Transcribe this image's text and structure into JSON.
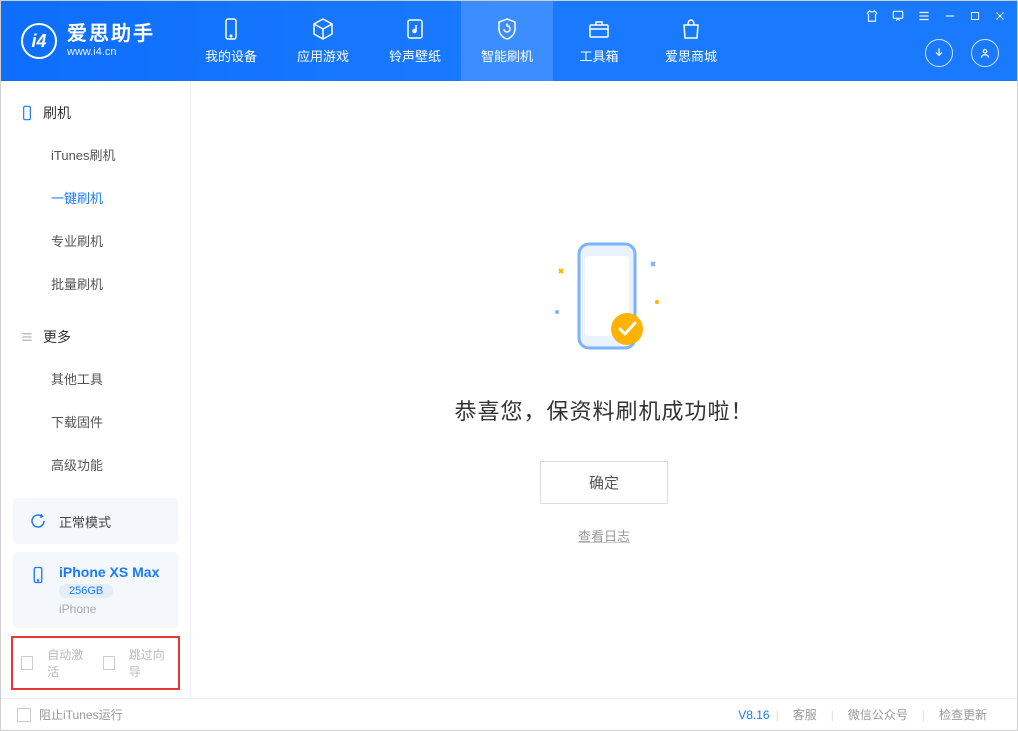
{
  "app": {
    "title": "爱思助手",
    "subtitle": "www.i4.cn"
  },
  "nav": {
    "my_device": "我的设备",
    "apps_games": "应用游戏",
    "ring_wall": "铃声壁纸",
    "smart_flash": "智能刷机",
    "toolbox": "工具箱",
    "store": "爱思商城"
  },
  "sidebar": {
    "section_flash": "刷机",
    "items_flash": {
      "itunes": "iTunes刷机",
      "oneclick": "一键刷机",
      "pro": "专业刷机",
      "batch": "批量刷机"
    },
    "section_more": "更多",
    "items_more": {
      "other_tools": "其他工具",
      "download_fw": "下载固件",
      "advanced": "高级功能"
    }
  },
  "device": {
    "mode": "正常模式",
    "name": "iPhone XS Max",
    "storage": "256GB",
    "type": "iPhone"
  },
  "options": {
    "auto_activate": "自动激活",
    "skip_guide": "跳过向导"
  },
  "main": {
    "success": "恭喜您，保资料刷机成功啦！",
    "ok": "确定",
    "view_log": "查看日志"
  },
  "footer": {
    "block_itunes": "阻止iTunes运行",
    "version": "V8.16",
    "support": "客服",
    "wechat": "微信公众号",
    "check_update": "检查更新"
  }
}
